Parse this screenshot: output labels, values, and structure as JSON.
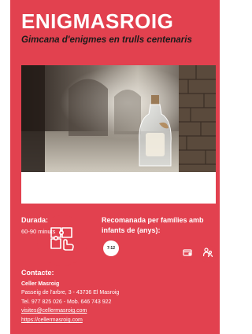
{
  "colors": {
    "accent": "#e2414f",
    "dark_text": "#1b1b1b"
  },
  "header": {
    "title": "ENIGMASROIG",
    "subtitle": "Gimcana d'enigmes en trulls centenaris"
  },
  "icons": {
    "badge": "puzzle-hand-icon",
    "action_1": "wallet-pay-icon",
    "action_2": "family-icon"
  },
  "duration": {
    "label": "Durada:",
    "value": "60-90 minuts"
  },
  "recommended": {
    "label_line1": "Recomanada per famílies amb",
    "label_line2": "infants de (anys):",
    "age_range": "7-12"
  },
  "contact": {
    "label": "Contacte:",
    "name": "Celler Masroig",
    "address": "Passeig de l'arbre, 3 - 43736 El Masroig",
    "phones": "Tel. 977 825 026 - Mob. 646 743 922",
    "email": "visites@cellermasroig.com",
    "website": "https://cellermasroig.com"
  }
}
